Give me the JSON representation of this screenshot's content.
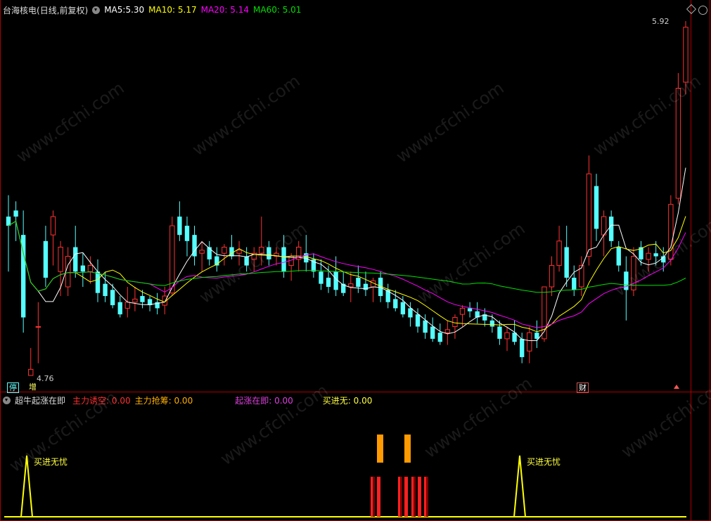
{
  "header": {
    "stock_name": "台海核电",
    "period": "(日线,前复权)",
    "ma5_label": "MA5:",
    "ma5_value": "5.30",
    "ma10_label": "MA10:",
    "ma10_value": "5.17",
    "ma20_label": "MA20:",
    "ma20_value": "5.14",
    "ma60_label": "MA60:",
    "ma60_value": "5.01"
  },
  "price_chart": {
    "high_label": "5.92",
    "low_label": "4.76",
    "badges": [
      "停",
      "增",
      "财"
    ]
  },
  "indicator": {
    "name": "超牛起涨在即",
    "items": [
      {
        "label": "主力诱空:",
        "value": "0.00",
        "color": "#ff3030"
      },
      {
        "label": "主力抢筹:",
        "value": "0.00",
        "color": "#ffb000"
      },
      {
        "label": "起涨在即:",
        "value": "0.00",
        "color": "#e040e0"
      },
      {
        "label": "买进无:",
        "value": "0.00",
        "color": "#ffff40"
      }
    ],
    "signal_label_1": "买进无忧",
    "signal_label_2": "买进无忧"
  },
  "watermark": "www.cfchi.com",
  "colors": {
    "up": "#ff3232",
    "down": "#54ffff",
    "ma5": "#ffffff",
    "ma10": "#ffff00",
    "ma20": "#ff00ff",
    "ma60": "#00e000",
    "border": "#a00000"
  },
  "chart_data": {
    "type": "candlestick",
    "ylim": [
      4.76,
      5.92
    ],
    "candles": [
      [
        5.28,
        5.35,
        5.1,
        5.25
      ],
      [
        5.3,
        5.33,
        5.2,
        5.28
      ],
      [
        5.22,
        5.3,
        4.9,
        4.95
      ],
      [
        4.76,
        4.85,
        4.76,
        4.78
      ],
      [
        4.92,
        5.0,
        4.8,
        4.92
      ],
      [
        5.2,
        5.25,
        5.05,
        5.08
      ],
      [
        5.22,
        5.3,
        5.12,
        5.28
      ],
      [
        5.1,
        5.2,
        5.02,
        5.18
      ],
      [
        5.05,
        5.18,
        5.02,
        5.15
      ],
      [
        5.18,
        5.25,
        5.08,
        5.1
      ],
      [
        5.12,
        5.16,
        5.05,
        5.1
      ],
      [
        5.1,
        5.15,
        5.06,
        5.12
      ],
      [
        5.1,
        5.14,
        5.0,
        5.03
      ],
      [
        5.06,
        5.1,
        5.0,
        5.02
      ],
      [
        5.04,
        5.06,
        4.98,
        4.99
      ],
      [
        5.0,
        5.02,
        4.95,
        4.96
      ],
      [
        4.98,
        5.05,
        4.95,
        5.0
      ],
      [
        5.0,
        5.05,
        4.97,
        5.01
      ],
      [
        5.02,
        5.04,
        4.98,
        5.0
      ],
      [
        5.01,
        5.02,
        4.97,
        4.99
      ],
      [
        5.0,
        5.03,
        4.96,
        4.98
      ],
      [
        4.99,
        5.05,
        4.96,
        5.02
      ],
      [
        5.03,
        5.28,
        5.02,
        5.25
      ],
      [
        5.28,
        5.33,
        5.2,
        5.22
      ],
      [
        5.25,
        5.28,
        5.15,
        5.2
      ],
      [
        5.22,
        5.25,
        5.12,
        5.15
      ],
      [
        5.16,
        5.2,
        5.1,
        5.17
      ],
      [
        5.18,
        5.2,
        5.12,
        5.14
      ],
      [
        5.15,
        5.18,
        5.1,
        5.12
      ],
      [
        5.16,
        5.19,
        5.12,
        5.18
      ],
      [
        5.18,
        5.22,
        5.14,
        5.15
      ],
      [
        5.16,
        5.2,
        5.12,
        5.17
      ],
      [
        5.15,
        5.18,
        5.1,
        5.12
      ],
      [
        5.14,
        5.18,
        5.1,
        5.16
      ],
      [
        5.16,
        5.28,
        5.12,
        5.18
      ],
      [
        5.18,
        5.2,
        5.12,
        5.14
      ],
      [
        5.15,
        5.18,
        5.12,
        5.16
      ],
      [
        5.18,
        5.22,
        5.08,
        5.1
      ],
      [
        5.12,
        5.16,
        5.07,
        5.15
      ],
      [
        5.14,
        5.2,
        5.1,
        5.18
      ],
      [
        5.16,
        5.22,
        5.1,
        5.13
      ],
      [
        5.14,
        5.16,
        5.08,
        5.1
      ],
      [
        5.1,
        5.14,
        5.04,
        5.06
      ],
      [
        5.08,
        5.12,
        5.03,
        5.05
      ],
      [
        5.1,
        5.15,
        5.02,
        5.04
      ],
      [
        5.06,
        5.1,
        5.02,
        5.03
      ],
      [
        5.05,
        5.1,
        5.0,
        5.06
      ],
      [
        5.08,
        5.12,
        5.03,
        5.05
      ],
      [
        5.06,
        5.1,
        5.02,
        5.04
      ],
      [
        5.05,
        5.08,
        5.0,
        5.07
      ],
      [
        5.08,
        5.1,
        5.0,
        5.02
      ],
      [
        5.04,
        5.06,
        4.98,
        5.0
      ],
      [
        5.01,
        5.04,
        4.97,
        4.98
      ],
      [
        5.0,
        5.02,
        4.95,
        4.96
      ],
      [
        4.98,
        5.0,
        4.92,
        4.95
      ],
      [
        4.96,
        4.98,
        4.9,
        4.92
      ],
      [
        4.94,
        4.96,
        4.88,
        4.9
      ],
      [
        4.92,
        4.95,
        4.87,
        4.88
      ],
      [
        4.9,
        4.93,
        4.86,
        4.87
      ],
      [
        4.9,
        4.94,
        4.86,
        4.91
      ],
      [
        4.92,
        4.96,
        4.88,
        4.95
      ],
      [
        4.96,
        4.99,
        4.92,
        4.98
      ],
      [
        4.98,
        5.0,
        4.95,
        4.97
      ],
      [
        4.97,
        5.0,
        4.93,
        4.95
      ],
      [
        4.96,
        4.98,
        4.92,
        4.94
      ],
      [
        4.94,
        4.96,
        4.9,
        4.92
      ],
      [
        4.92,
        4.94,
        4.86,
        4.88
      ],
      [
        4.88,
        4.92,
        4.84,
        4.9
      ],
      [
        4.9,
        4.94,
        4.86,
        4.87
      ],
      [
        4.88,
        4.9,
        4.8,
        4.82
      ],
      [
        4.84,
        4.92,
        4.8,
        4.9
      ],
      [
        4.9,
        4.94,
        4.85,
        4.88
      ],
      [
        4.88,
        5.05,
        4.87,
        5.05
      ],
      [
        5.05,
        5.15,
        5.02,
        5.12
      ],
      [
        5.12,
        5.25,
        5.1,
        5.2
      ],
      [
        5.18,
        5.25,
        5.05,
        5.08
      ],
      [
        5.08,
        5.12,
        5.02,
        5.04
      ],
      [
        5.05,
        5.15,
        5.02,
        5.12
      ],
      [
        5.15,
        5.48,
        5.12,
        5.42
      ],
      [
        5.38,
        5.42,
        5.2,
        5.24
      ],
      [
        5.22,
        5.3,
        5.15,
        5.28
      ],
      [
        5.28,
        5.3,
        5.18,
        5.2
      ],
      [
        5.18,
        5.2,
        5.1,
        5.12
      ],
      [
        5.1,
        5.15,
        4.94,
        5.04
      ],
      [
        5.04,
        5.18,
        5.02,
        5.15
      ],
      [
        5.18,
        5.2,
        5.12,
        5.14
      ],
      [
        5.14,
        5.18,
        5.1,
        5.16
      ],
      [
        5.16,
        5.2,
        5.12,
        5.15
      ],
      [
        5.15,
        5.18,
        5.1,
        5.13
      ],
      [
        5.14,
        5.35,
        5.12,
        5.32
      ],
      [
        5.34,
        5.75,
        5.32,
        5.7
      ],
      [
        5.72,
        5.92,
        5.68,
        5.9
      ]
    ]
  }
}
